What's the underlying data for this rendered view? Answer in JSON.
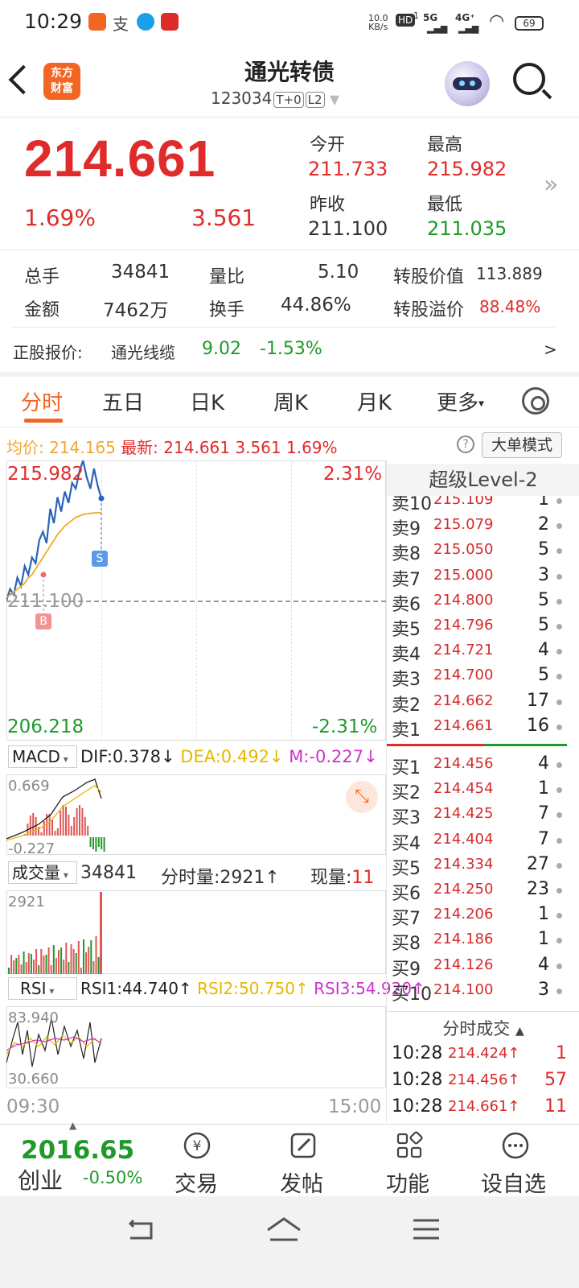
{
  "status_bar": {
    "time": "10:29",
    "net_speed_value": "10.0",
    "net_speed_unit": "KB/s",
    "hd_label": "HD",
    "sim1": "1",
    "sim2": "2",
    "network1": "5G",
    "network2": "4G⁺",
    "battery": "69"
  },
  "header": {
    "logo_line1": "东方",
    "logo_line2": "财富",
    "title": "通光转债",
    "code": "123034",
    "tag1": "T+0",
    "tag2": "L2"
  },
  "quote": {
    "price": "214.661",
    "change_pct": "1.69%",
    "change": "3.561",
    "open_label": "今开",
    "open": "211.733",
    "high_label": "最高",
    "high": "215.982",
    "prev_close_label": "昨收",
    "prev_close": "211.100",
    "low_label": "最低",
    "low": "211.035"
  },
  "stats": {
    "volume_label": "总手",
    "volume": "34841",
    "ratio_label": "量比",
    "ratio": "5.10",
    "conv_value_label": "转股价值",
    "conv_value": "113.889",
    "amount_label": "金额",
    "amount": "7462万",
    "turnover_label": "换手",
    "turnover": "44.86%",
    "premium_label": "转股溢价",
    "premium": "88.48%"
  },
  "underlying": {
    "label": "正股报价:",
    "name": "通光线缆",
    "price": "9.02",
    "change": "-1.53%",
    "arrow": ">"
  },
  "tabs": [
    {
      "label": "分时"
    },
    {
      "label": "五日"
    },
    {
      "label": "日K"
    },
    {
      "label": "周K"
    },
    {
      "label": "月K"
    },
    {
      "label": "更多"
    }
  ],
  "more_caret": "▾",
  "info_line": {
    "avg_label": "均价:",
    "avg": "214.165",
    "latest_label": "最新:",
    "latest": "214.661",
    "change": "3.561",
    "change_pct": "1.69%",
    "help": "?",
    "big_order_mode": "大单模式"
  },
  "chart": {
    "top_price": "215.982",
    "top_pct": "2.31%",
    "mid_price": "211.100",
    "bottom_price": "206.218",
    "bottom_pct": "-2.31%",
    "buy_marker": "B",
    "sell_marker": "S",
    "time_start": "09:30",
    "time_end": "15:00",
    "macd": {
      "selector": "MACD",
      "dif": "DIF:0.378↓",
      "dea": "DEA:0.492↓",
      "m": "M:-0.227↓",
      "top": "0.669",
      "bottom": "-0.227"
    },
    "volume": {
      "selector": "成交量",
      "total": "34841",
      "tick_label": "分时量:2921↑",
      "now_label": "现量:",
      "now": "11",
      "max": "2921"
    },
    "rsi": {
      "selector": "RSI",
      "rsi1": "RSI1:44.740↑",
      "rsi2": "RSI2:50.750↑",
      "rsi3": "RSI3:54.920↑",
      "top": "83.940",
      "bottom": "30.660"
    }
  },
  "chart_data": {
    "type": "line",
    "title": "",
    "xlabel": "",
    "ylabel": "",
    "x_range": [
      "09:30",
      "15:00"
    ],
    "ylim": [
      206.218,
      215.982
    ],
    "baseline": 211.1,
    "series": [
      {
        "values": [
          211.1,
          211.5,
          211.3,
          211.9,
          211.6,
          212.3,
          212.0,
          212.6,
          212.4,
          213.2,
          213.5,
          213.1,
          214.3,
          213.8,
          214.7,
          214.2,
          214.9,
          214.5,
          215.2,
          215.0,
          215.6,
          215.982,
          215.4,
          215.0,
          215.7,
          215.1,
          214.661
        ]
      },
      {
        "values": [
          211.2,
          211.3,
          211.4,
          211.5,
          211.6,
          211.7,
          211.9,
          212.0,
          212.2,
          212.4,
          212.6,
          212.8,
          213.0,
          213.2,
          213.4,
          213.55,
          213.7,
          213.8,
          213.9,
          214.0,
          214.05,
          214.1,
          214.12,
          214.14,
          214.15,
          214.16,
          214.165
        ]
      }
    ]
  },
  "order_book": {
    "header": "超级Level-2",
    "asks": [
      {
        "label": "卖10",
        "price": "215.109",
        "vol": "1"
      },
      {
        "label": "卖9",
        "price": "215.079",
        "vol": "2"
      },
      {
        "label": "卖8",
        "price": "215.050",
        "vol": "5"
      },
      {
        "label": "卖7",
        "price": "215.000",
        "vol": "3"
      },
      {
        "label": "卖6",
        "price": "214.800",
        "vol": "5"
      },
      {
        "label": "卖5",
        "price": "214.796",
        "vol": "5"
      },
      {
        "label": "卖4",
        "price": "214.721",
        "vol": "4"
      },
      {
        "label": "卖3",
        "price": "214.700",
        "vol": "5"
      },
      {
        "label": "卖2",
        "price": "214.662",
        "vol": "17"
      },
      {
        "label": "卖1",
        "price": "214.661",
        "vol": "16"
      }
    ],
    "bids": [
      {
        "label": "买1",
        "price": "214.456",
        "vol": "4"
      },
      {
        "label": "买2",
        "price": "214.454",
        "vol": "1"
      },
      {
        "label": "买3",
        "price": "214.425",
        "vol": "7"
      },
      {
        "label": "买4",
        "price": "214.404",
        "vol": "7"
      },
      {
        "label": "买5",
        "price": "214.334",
        "vol": "27"
      },
      {
        "label": "买6",
        "price": "214.250",
        "vol": "23"
      },
      {
        "label": "买7",
        "price": "214.206",
        "vol": "1"
      },
      {
        "label": "买8",
        "price": "214.186",
        "vol": "1"
      },
      {
        "label": "买9",
        "price": "214.126",
        "vol": "4"
      },
      {
        "label": "买10",
        "price": "214.100",
        "vol": "3"
      }
    ],
    "ticks_header": "分时成交",
    "ticks_caret": "▲",
    "ticks": [
      {
        "time": "10:28",
        "price": "214.424↑",
        "vol": "1"
      },
      {
        "time": "10:28",
        "price": "214.456↑",
        "vol": "57"
      },
      {
        "time": "10:28",
        "price": "214.661↑",
        "vol": "11"
      }
    ]
  },
  "bottom_bar": {
    "index_value": "2016.65",
    "index_name": "创业",
    "index_change": "-0.50%",
    "items": [
      {
        "label": "交易",
        "icon": "trade-yen-icon"
      },
      {
        "label": "发帖",
        "icon": "post-edit-icon"
      },
      {
        "label": "功能",
        "icon": "function-grid-icon"
      },
      {
        "label": "设自选",
        "icon": "watchlist-dots-icon"
      }
    ]
  },
  "colors": {
    "up": "#e02b2b",
    "down": "#1f9a2a",
    "accent": "#f26522",
    "price_line": "#2b63b8",
    "avg_line": "#f0a830"
  }
}
